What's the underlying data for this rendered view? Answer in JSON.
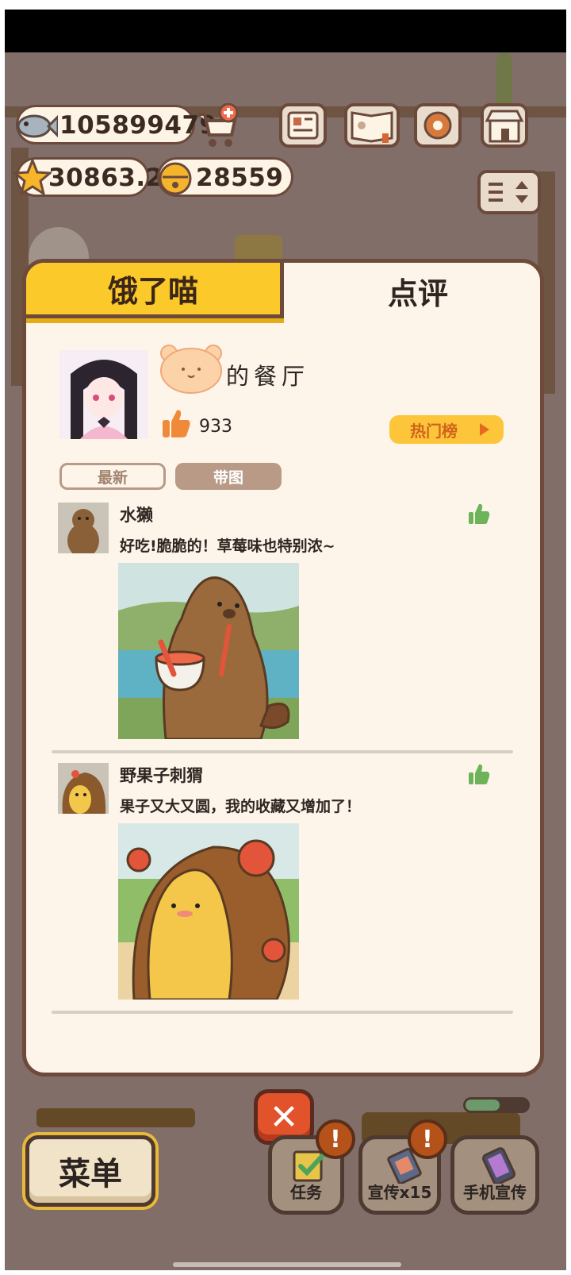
{
  "hud": {
    "fish": "105899479",
    "stars": "30863.2",
    "bells": "28559"
  },
  "tabs": {
    "hungry": "饿了喵",
    "review": "点评"
  },
  "restaurant": {
    "name_suffix": "的餐厅",
    "likes": "933",
    "hot_list": "热门榜"
  },
  "filters": {
    "newest": "最新",
    "with_image": "带图"
  },
  "reviews": [
    {
      "name": "水獭",
      "text": "好吃!脆脆的！草莓味也特别浓~",
      "avatar": "otter-avatar",
      "image": "otter-eating-image"
    },
    {
      "name": "野果子刺猬",
      "text": "果子又大又圆，我的收藏又增加了！",
      "avatar": "hedgehog-avatar",
      "image": "hedgehog-apple-image"
    }
  ],
  "bottom_bar": {
    "menu": "菜单",
    "tasks": "任务",
    "promote": "宣传x15",
    "phone_promote": "手机宣传",
    "close": "✕",
    "alert": "!",
    "progress": 0.55
  },
  "colors": {
    "tab_active": "#fcc92a",
    "panel_bg": "#fdf5ea",
    "border": "#6e4a3a",
    "hot_btn": "#fcc53a",
    "like_green": "#6cb35a"
  }
}
